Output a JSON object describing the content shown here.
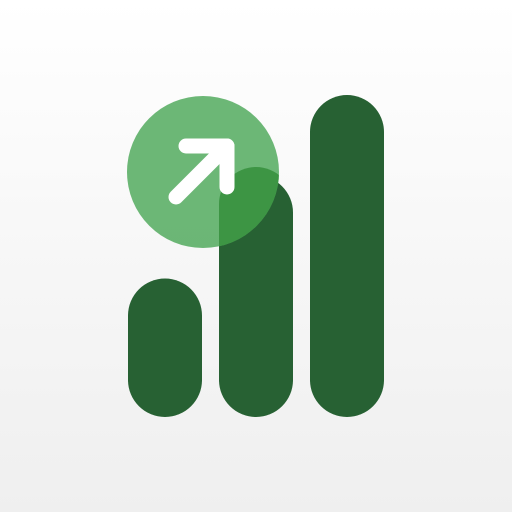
{
  "icon": {
    "name": "growth-chart-app-icon",
    "colors": {
      "bar": "#276133",
      "badge": "#58AD63",
      "badge_overlap": "#3D9544",
      "arrow": "#FFFFFF"
    },
    "bars": [
      {
        "name": "bar-short",
        "level": 0.43
      },
      {
        "name": "bar-medium",
        "level": 0.75
      },
      {
        "name": "bar-tall",
        "level": 1.0
      }
    ]
  }
}
